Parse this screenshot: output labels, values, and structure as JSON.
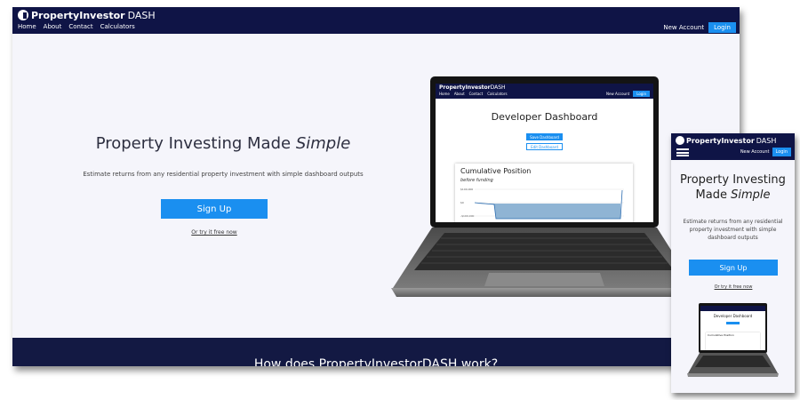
{
  "site": {
    "brand_bold": "PropertyInvestor",
    "brand_light": "DASH",
    "nav_links": [
      "Home",
      "About",
      "Contact",
      "Calculators"
    ],
    "new_account": "New Account",
    "login": "Login"
  },
  "hero": {
    "title": "Property Investing Made ",
    "title_em": "Simple",
    "subtitle": "Estimate returns from any residential property investment with simple dashboard outputs",
    "signup": "Sign Up",
    "try_free": "Or try it free now"
  },
  "footer": {
    "heading": "How does PropertyInvestorDASH work?"
  },
  "laptop_screen": {
    "title": "Developer Dashboard",
    "save": "Save Dashboard",
    "edit": "Edit Dashboard",
    "card_title": "Cumulative Position",
    "card_sub": "before funding",
    "ticks": [
      "$100,000",
      "$0",
      "-$100,000"
    ],
    "mini_bar_color": "#8fb4d4"
  },
  "mobile": {
    "title_line1": "Property Investing",
    "title_line2": "Made ",
    "title_em": "Simple",
    "subtitle": "Estimate returns from any residential property investment with simple dashboard outputs"
  },
  "colors": {
    "navy": "#0f1446",
    "accent": "#1a8ff0",
    "page_bg": "#f5f5fb"
  },
  "icons": {
    "logo": "house-person-logo-icon",
    "menu": "hamburger-menu-icon"
  }
}
